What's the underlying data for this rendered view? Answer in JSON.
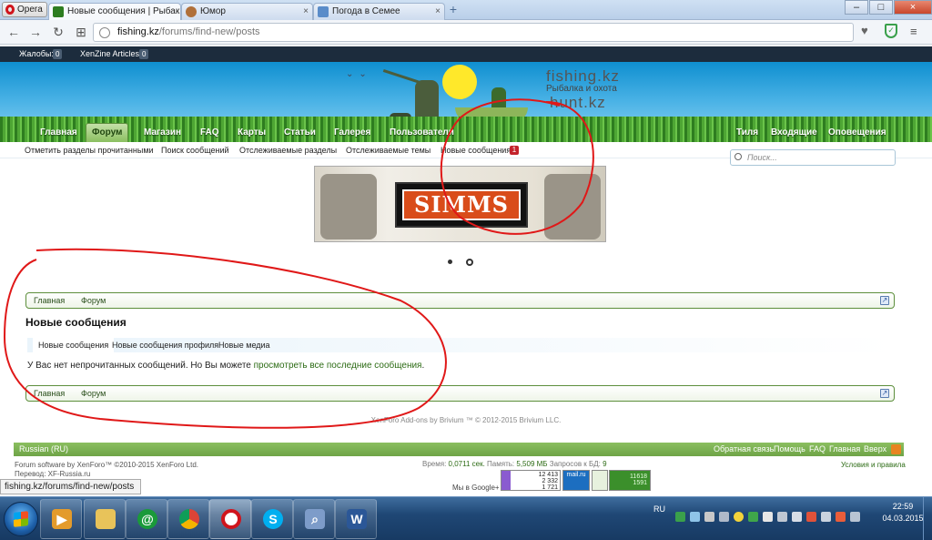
{
  "browser": {
    "app_label": "Opera",
    "tabs": [
      {
        "title": "Новые сообщения | Рыбак",
        "active": true
      },
      {
        "title": "Юмор",
        "active": false
      },
      {
        "title": "Погода в Семее",
        "active": false
      }
    ],
    "url_host": "fishing.kz",
    "url_path": "/forums/find-new/posts",
    "new_tab_symbol": "+",
    "heart_symbol": "♥",
    "menu_symbol": "≡"
  },
  "topbar": {
    "complaints_label": "Жалобы:",
    "complaints_count": "0",
    "articles_label": "XenZine Articles:",
    "articles_count": "0"
  },
  "header": {
    "logo_line1": "fishing.kz",
    "logo_line2": "Рыбалка и охота",
    "logo_line3": "hunt.kz"
  },
  "nav": {
    "items": [
      "Главная",
      "Форум",
      "Магазин",
      "FAQ",
      "Карты",
      "Статьи",
      "Галерея",
      "Пользователи"
    ],
    "right": [
      "Тиля",
      "Входящие",
      "Оповещения"
    ]
  },
  "subnav": {
    "items": [
      "Отметить разделы прочитанными",
      "Поиск сообщений",
      "Отслеживаемые разделы",
      "Отслеживаемые темы",
      "Новые сообщения"
    ],
    "badge": "1"
  },
  "search": {
    "placeholder": "Поиск..."
  },
  "banner": {
    "brand": "SIMMS"
  },
  "breadcrumb": {
    "items": [
      "Главная",
      "Форум"
    ]
  },
  "page": {
    "title": "Новые сообщения",
    "tabs": [
      "Новые сообщения",
      "Новые сообщения профиля",
      "Новые медиа"
    ],
    "message_text": "У Вас нет непрочитанных сообщений. Но Вы можете ",
    "message_link": "просмотреть все последние сообщения",
    "message_end": "."
  },
  "footer": {
    "copyright": "XenForo Add-ons by Brivium ™ © 2012-2015 Brivium LLC.",
    "language": "Russian (RU)",
    "links": [
      "Обратная связь",
      "Помощь",
      "FAQ",
      "Главная",
      "Вверх"
    ],
    "software": "Forum software by XenForo™ ©2010-2015 XenForo Ltd.",
    "translation": "Перевод: XF-Russia.ru",
    "time_label": "Время:",
    "time_value": "0,0711 сек.",
    "memory_label": "Память:",
    "memory_value": "5,509 МБ",
    "queries_label": "Запросов к БД:",
    "queries_value": "9",
    "rules": "Условия и правила",
    "google": "Мы в Google+",
    "counter1": [
      "12 413",
      "2 332",
      "1 721"
    ],
    "counter2": "mail.ru",
    "counter4": [
      "11618",
      "1591"
    ]
  },
  "status_url": "fishing.kz/forums/find-new/posts",
  "taskbar": {
    "lang": "RU",
    "time": "22:59",
    "date": "04.03.2015"
  }
}
